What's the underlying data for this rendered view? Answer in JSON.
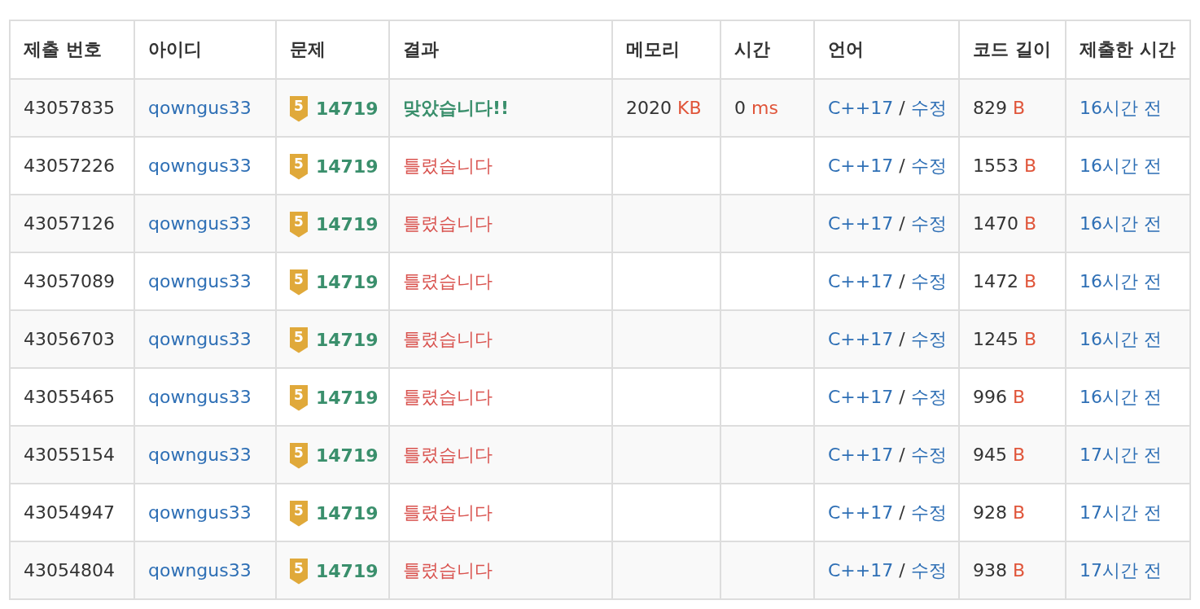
{
  "table": {
    "columns": [
      "제출 번호",
      "아이디",
      "문제",
      "결과",
      "메모리",
      "시간",
      "언어",
      "코드 길이",
      "제출한 시간"
    ],
    "rows": [
      {
        "id": "43057835",
        "user": "qowngus33",
        "problem": {
          "tier": "5",
          "number": "14719"
        },
        "result": {
          "kind": "accepted",
          "text": "맞았습니다!!"
        },
        "memory": {
          "value": "2020",
          "unit": "KB"
        },
        "time": {
          "value": "0",
          "unit": "ms"
        },
        "language": {
          "name": "C++17",
          "separator": "/",
          "edit": "수정"
        },
        "code_length": {
          "value": "829",
          "unit": "B"
        },
        "submitted": "16시간 전"
      },
      {
        "id": "43057226",
        "user": "qowngus33",
        "problem": {
          "tier": "5",
          "number": "14719"
        },
        "result": {
          "kind": "wrong",
          "text": "틀렸습니다"
        },
        "language": {
          "name": "C++17",
          "separator": "/",
          "edit": "수정"
        },
        "code_length": {
          "value": "1553",
          "unit": "B"
        },
        "submitted": "16시간 전"
      },
      {
        "id": "43057126",
        "user": "qowngus33",
        "problem": {
          "tier": "5",
          "number": "14719"
        },
        "result": {
          "kind": "wrong",
          "text": "틀렸습니다"
        },
        "language": {
          "name": "C++17",
          "separator": "/",
          "edit": "수정"
        },
        "code_length": {
          "value": "1470",
          "unit": "B"
        },
        "submitted": "16시간 전"
      },
      {
        "id": "43057089",
        "user": "qowngus33",
        "problem": {
          "tier": "5",
          "number": "14719"
        },
        "result": {
          "kind": "wrong",
          "text": "틀렸습니다"
        },
        "language": {
          "name": "C++17",
          "separator": "/",
          "edit": "수정"
        },
        "code_length": {
          "value": "1472",
          "unit": "B"
        },
        "submitted": "16시간 전"
      },
      {
        "id": "43056703",
        "user": "qowngus33",
        "problem": {
          "tier": "5",
          "number": "14719"
        },
        "result": {
          "kind": "wrong",
          "text": "틀렸습니다"
        },
        "language": {
          "name": "C++17",
          "separator": "/",
          "edit": "수정"
        },
        "code_length": {
          "value": "1245",
          "unit": "B"
        },
        "submitted": "16시간 전"
      },
      {
        "id": "43055465",
        "user": "qowngus33",
        "problem": {
          "tier": "5",
          "number": "14719"
        },
        "result": {
          "kind": "wrong",
          "text": "틀렸습니다"
        },
        "language": {
          "name": "C++17",
          "separator": "/",
          "edit": "수정"
        },
        "code_length": {
          "value": "996",
          "unit": "B"
        },
        "submitted": "16시간 전"
      },
      {
        "id": "43055154",
        "user": "qowngus33",
        "problem": {
          "tier": "5",
          "number": "14719"
        },
        "result": {
          "kind": "wrong",
          "text": "틀렸습니다"
        },
        "language": {
          "name": "C++17",
          "separator": "/",
          "edit": "수정"
        },
        "code_length": {
          "value": "945",
          "unit": "B"
        },
        "submitted": "17시간 전"
      },
      {
        "id": "43054947",
        "user": "qowngus33",
        "problem": {
          "tier": "5",
          "number": "14719"
        },
        "result": {
          "kind": "wrong",
          "text": "틀렸습니다"
        },
        "language": {
          "name": "C++17",
          "separator": "/",
          "edit": "수정"
        },
        "code_length": {
          "value": "928",
          "unit": "B"
        },
        "submitted": "17시간 전"
      },
      {
        "id": "43054804",
        "user": "qowngus33",
        "problem": {
          "tier": "5",
          "number": "14719"
        },
        "result": {
          "kind": "wrong",
          "text": "틀렸습니다"
        },
        "language": {
          "name": "C++17",
          "separator": "/",
          "edit": "수정"
        },
        "code_length": {
          "value": "938",
          "unit": "B"
        },
        "submitted": "17시간 전"
      }
    ]
  }
}
